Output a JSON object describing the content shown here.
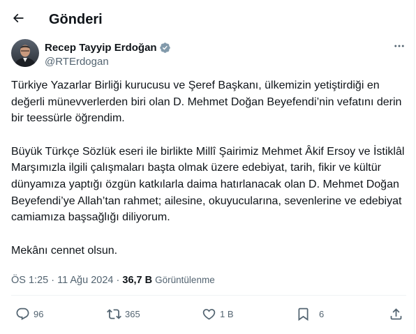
{
  "header": {
    "title": "Gönderi"
  },
  "author": {
    "name": "Recep Tayyip Erdoğan",
    "handle": "@RTErdogan",
    "verified": true
  },
  "tweet": {
    "paragraphs": [
      "Türkiye Yazarlar Birliği kurucusu ve Şeref Başkanı, ülkemizin yetiştirdiği en değerli münevverlerden biri olan D. Mehmet Doğan Beyefendi’nin vefatını derin bir teessürle öğrendim.",
      "Büyük Türkçe Sözlük eseri ile birlikte Millî Şairimiz Mehmet Âkif Ersoy ve İstiklâl Marşımızla ilgili çalışmaları başta olmak üzere edebiyat, tarih, fikir ve kültür dünyamıza yaptığı özgün katkılarla daima hatırlanacak olan D. Mehmet Doğan Beyefendi’ye Allah’tan rahmet; ailesine, okuyucularına, sevenlerine ve edebiyat camiamıza başsağlığı diliyorum.",
      "Mekânı cennet olsun."
    ]
  },
  "meta": {
    "time": "ÖS 1:25",
    "separator": "·",
    "date": "11 Ağu 2024",
    "views_count": "36,7 B",
    "views_label": "Görüntülenme"
  },
  "actions": {
    "replies": "96",
    "reposts": "365",
    "likes": "1 B",
    "bookmarks": "6"
  },
  "icons": {
    "back": "back-arrow-icon",
    "verified": "verified-badge-icon",
    "more": "more-icon",
    "reply": "reply-icon",
    "repost": "repost-icon",
    "like": "like-icon",
    "bookmark": "bookmark-icon",
    "share": "share-icon"
  },
  "colors": {
    "text": "#0f1419",
    "secondary": "#536471",
    "divider": "#eff3f4"
  }
}
